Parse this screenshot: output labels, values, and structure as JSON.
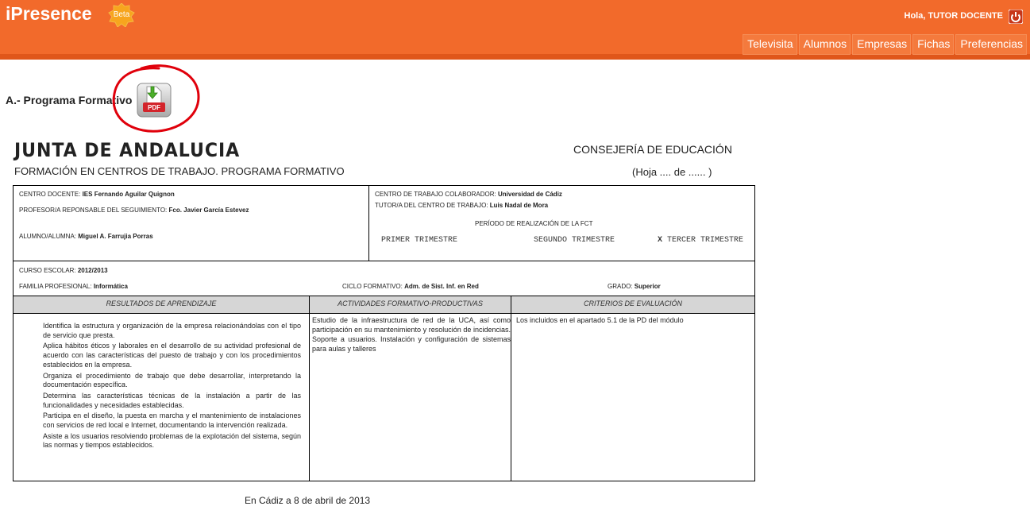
{
  "app": {
    "title": "iPresence",
    "badge": "Beta",
    "greeting": "Hola, TUTOR DOCENTE"
  },
  "nav": {
    "items": [
      "Televisita",
      "Alumnos",
      "Empresas",
      "Fichas",
      "Preferencias"
    ]
  },
  "section": {
    "title": "A.- Programa Formativo"
  },
  "document": {
    "brand": "JUNTA DE ANDALUCIA",
    "department": "CONSEJERÍA DE EDUCACIÓN",
    "subtitle": "FORMACIÓN EN CENTROS DE TRABAJO. PROGRAMA FORMATIVO",
    "page": "(Hoja .... de ...... )",
    "centro_docente_label": "CENTRO DOCENTE:",
    "centro_docente": "IES Fernando Aguilar Quignon",
    "profesor_label": "PROFESOR/A REPONSABLE DEL SEGUIMIENTO:",
    "profesor": "Fco. Javier García Estevez",
    "alumno_label": "ALUMNO/ALUMNA:",
    "alumno": "Miguel A. Farrujia Porras",
    "centro_trabajo_label": "CENTRO DE TRABAJO COLABORADOR:",
    "centro_trabajo": "Universidad de Cádiz",
    "tutor_label": "TUTOR/A DEL CENTRO DE TRABAJO:",
    "tutor": "Luis Nadal de Mora",
    "periodo_label": "PERÍODO DE REALIZACIÓN DE LA FCT",
    "trimestre_1": "PRIMER TRIMESTRE",
    "trimestre_2": "SEGUNDO TRIMESTRE",
    "trimestre_mark": "X",
    "trimestre_3": "TERCER TRIMESTRE",
    "curso_label": "CURSO ESCOLAR:",
    "curso": "2012/2013",
    "familia_label": "FAMILIA PROFESIONAL:",
    "familia": "Informática",
    "ciclo_label": "CICLO FORMATIVO:",
    "ciclo": "Adm. de Sist. Inf. en Red",
    "grado_label": "GRADO:",
    "grado": "Superior",
    "columns": [
      "RESULTADOS DE APRENDIZAJE",
      "ACTIVIDADES FORMATIVO-PRODUCTIVAS",
      "CRITERIOS DE EVALUACIÓN"
    ],
    "resultados": [
      "Identifica la estructura y organización de la empresa relacionándolas con el tipo de servicio que presta.",
      "Aplica hábitos éticos y laborales en el desarrollo de su actividad profesional de acuerdo con las características del puesto de trabajo y con los procedimientos establecidos en la empresa.",
      "Organiza el procedimiento de trabajo que debe desarrollar, interpretando la documentación específica.",
      "Determina las características técnicas de la instalación a partir de las funcionalidades y necesidades establecidas.",
      "Participa en el diseño, la puesta en marcha y el mantenimiento de instalaciones con servicios de red local e Internet, documentando la intervención realizada.",
      "Asiste a los usuarios resolviendo problemas de la explotación del sistema, según las normas y tiempos establecidos."
    ],
    "actividades": "Estudio de la infraestructura de red de la UCA, así como participación en su mantenimiento y resolución de incidencias. Soporte a usuarios. Instalación y configuración de sistemas para aulas y talleres",
    "criterios": "Los incluidos en el apartado 5.1 de la PD del módulo",
    "footer": "En Cádiz a 8 de abril de 2013"
  },
  "colors": {
    "header": "#f26a2b",
    "header_shadow": "#e0561a",
    "annotation": "#e0000b",
    "table_header": "#d6d6d6"
  },
  "icons": [
    "beta-badge-icon",
    "power-icon",
    "pdf-download-icon"
  ]
}
